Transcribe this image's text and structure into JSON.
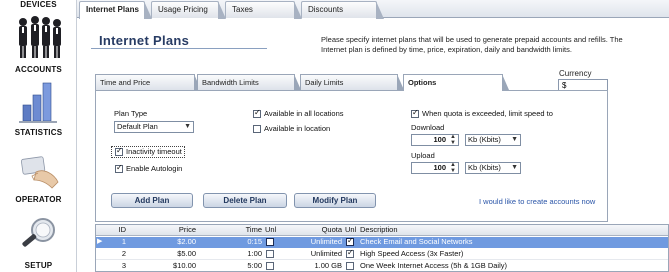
{
  "sidebar": {
    "items": [
      {
        "label": "DEVICES",
        "icon": "devices-icon"
      },
      {
        "label": "ACCOUNTS",
        "icon": "accounts-icon"
      },
      {
        "label": "STATISTICS",
        "icon": "statistics-icon"
      },
      {
        "label": "OPERATOR",
        "icon": "operator-icon"
      },
      {
        "label": "SETUP",
        "icon": "setup-icon"
      }
    ]
  },
  "top_tabs": [
    {
      "label": "Internet Plans",
      "active": true
    },
    {
      "label": "Usage Pricing",
      "active": false
    },
    {
      "label": "Taxes",
      "active": false
    },
    {
      "label": "Discounts",
      "active": false
    }
  ],
  "page": {
    "title": "Internet Plans",
    "description": "Please specify internet plans that will be used to generate prepaid accounts and refills. The Internet plan is defined by time, price, expiration, daily and bandwidth limits.",
    "currency_label": "Currency",
    "currency_value": "$"
  },
  "sub_tabs": [
    {
      "label": "Time and Price",
      "active": false
    },
    {
      "label": "Bandwidth Limits",
      "active": false
    },
    {
      "label": "Daily Limits",
      "active": false
    },
    {
      "label": "Options",
      "active": true
    }
  ],
  "options": {
    "plan_type_label": "Plan Type",
    "plan_type_value": "Default Plan",
    "inactivity_timeout_label": "Inactivity timeout",
    "inactivity_timeout_checked": true,
    "enable_autologin_label": "Enable Autologin",
    "enable_autologin_checked": true,
    "available_all_label": "Available in all locations",
    "available_all_checked": true,
    "available_in_label": "Available in location",
    "available_in_checked": false,
    "quota_limit_label": "When quota is exceeded, limit speed to",
    "quota_limit_checked": true,
    "download_label": "Download",
    "download_value": "100",
    "download_unit": "Kb (Kbits)",
    "upload_label": "Upload",
    "upload_value": "100",
    "upload_unit": "Kb (Kbits)"
  },
  "buttons": {
    "add": "Add Plan",
    "delete": "Delete Plan",
    "modify": "Modify Plan"
  },
  "create_accounts_link": "I would like to create accounts now",
  "table": {
    "columns": [
      "ID",
      "Price",
      "Time",
      "Unl",
      "Quota",
      "Unl",
      "Description"
    ],
    "rows": [
      {
        "id": "1",
        "price": "$2.00",
        "time": "0:15",
        "time_unl": false,
        "quota": "Unlimited",
        "quota_unl": true,
        "description": "Check Email and Social Networks",
        "selected": true
      },
      {
        "id": "2",
        "price": "$5.00",
        "time": "1:00",
        "time_unl": false,
        "quota": "Unlimited",
        "quota_unl": true,
        "description": "High Speed Access (3x Faster)",
        "selected": false
      },
      {
        "id": "3",
        "price": "$10.00",
        "time": "5:00",
        "time_unl": false,
        "quota": "1.00 GB",
        "quota_unl": false,
        "description": "One Week Internet Access (5h & 1GB Daily)",
        "selected": false
      }
    ]
  },
  "colors": {
    "title": "#283c64",
    "selected_row": "#6f9ae0",
    "link": "#2a55a8"
  }
}
